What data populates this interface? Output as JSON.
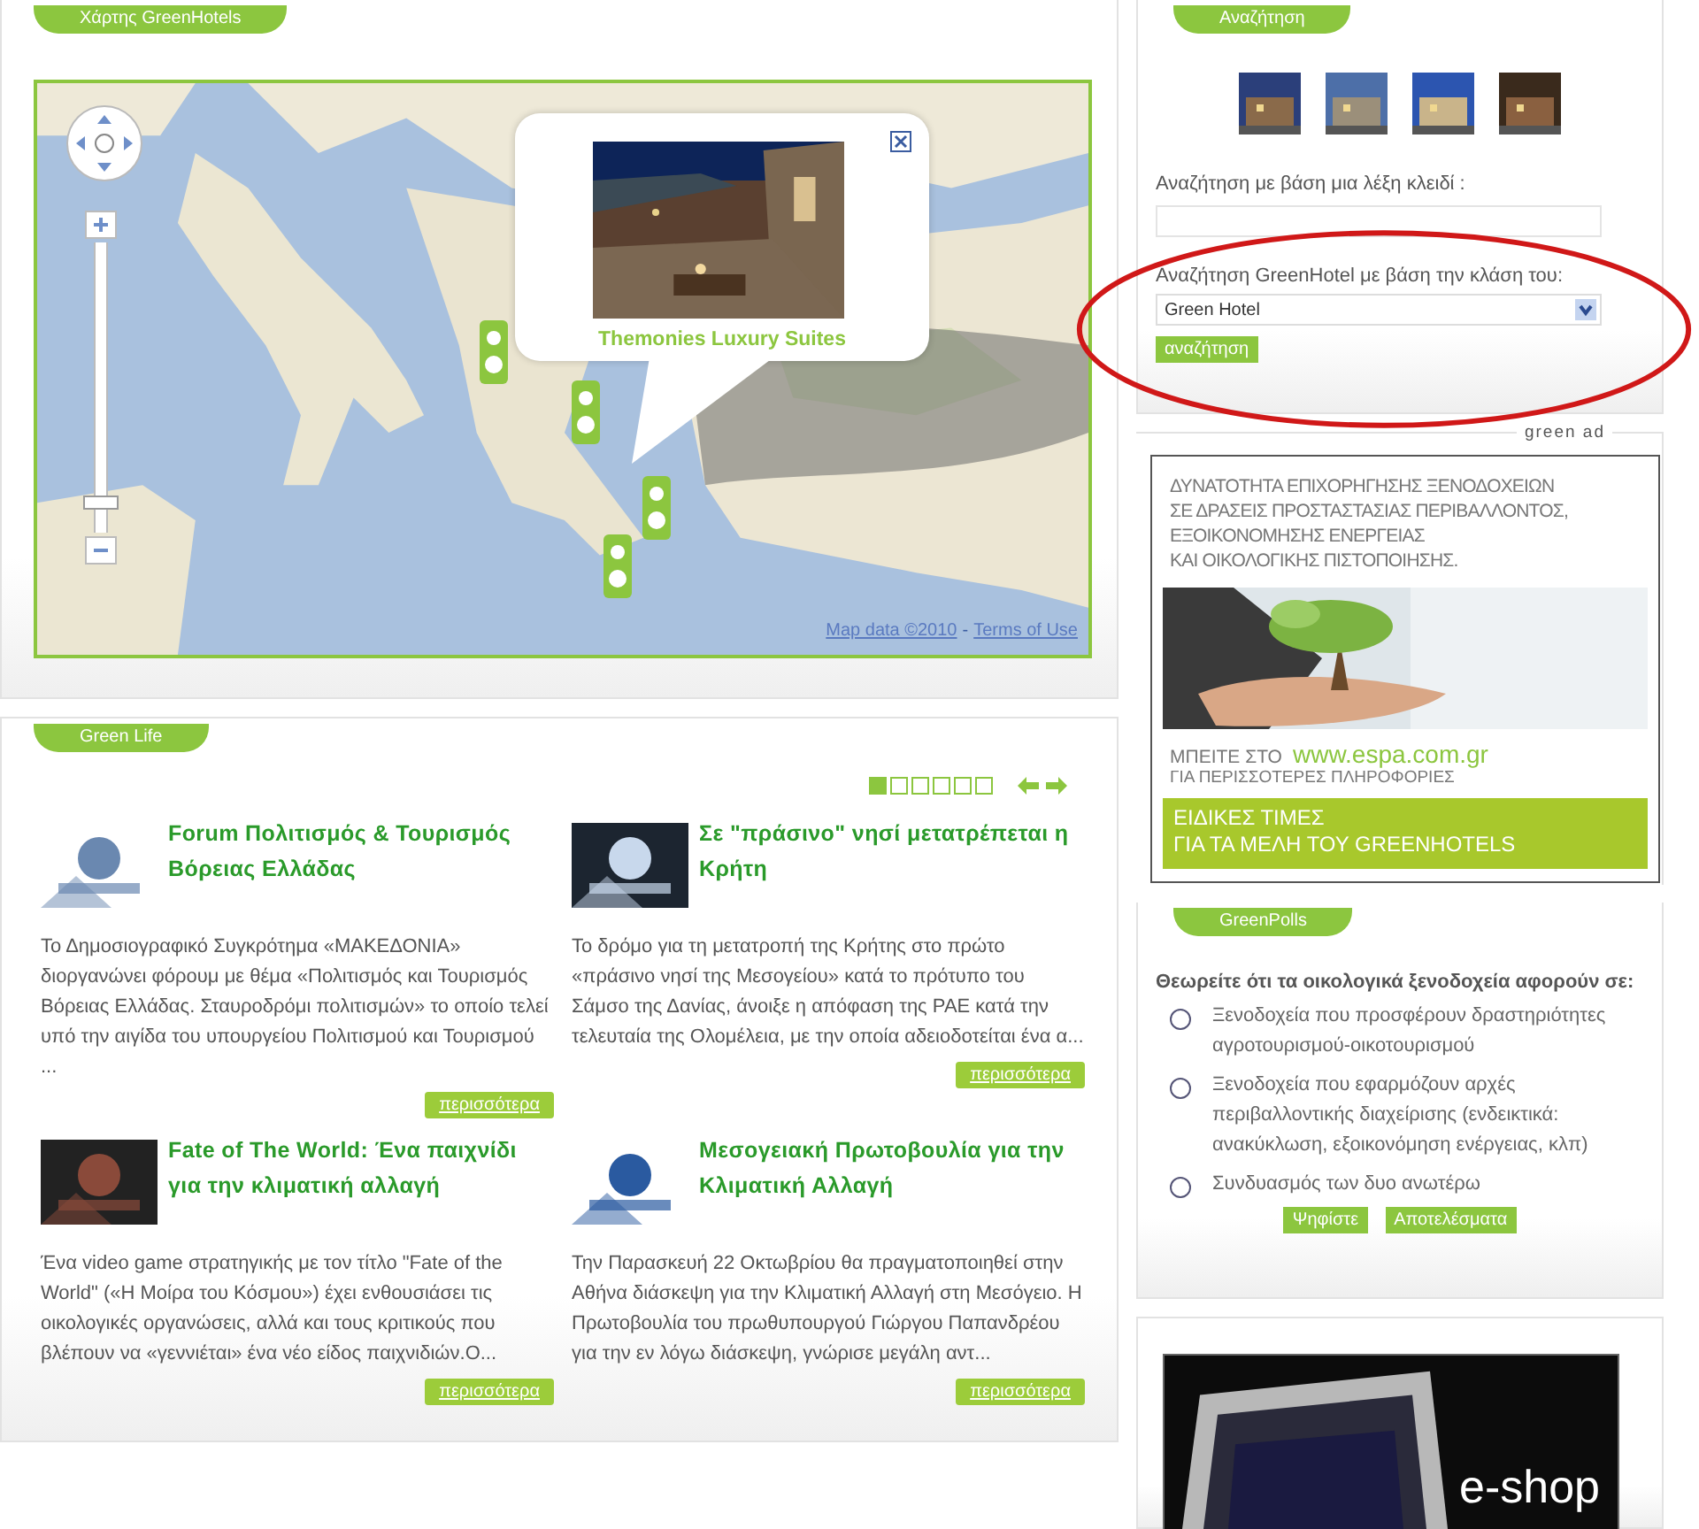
{
  "map_section": {
    "tab_label": "Χάρτης GreenHotels",
    "popup": {
      "title": "Themonies Luxury Suites"
    },
    "zoom": {
      "level": 0.08
    },
    "attribution": {
      "data_link": "Map data ©2010",
      "separator": "-",
      "terms_link": "Terms of Use"
    }
  },
  "search": {
    "tab_label": "Αναζήτηση",
    "keyword_label": "Αναζήτηση με βάση μια λέξη κλειδί :",
    "class_label": "Αναζήτηση GreenHotel με βάση την κλάση του:",
    "class_value": "Green Hotel",
    "button": "αναζήτηση"
  },
  "ad": {
    "caption": "green ad",
    "headline": [
      "ΔΥΝΑΤΟΤΗΤΑ ΕΠΙΧΟΡΗΓΗΣΗΣ ΞΕΝΟΔΟΧΕΙΩΝ",
      "ΣΕ ΔΡΑΣΕΙΣ ΠΡΟΣΤΑΣΤΑΣΙΑΣ ΠΕΡΙΒΑΛΛΟΝΤΟΣ,",
      "ΕΞΟΙΚΟΝΟΜΗΣΗΣ ΕΝΕΡΓΕΙΑΣ",
      "ΚΑΙ ΟΙΚΟΛΟΓΙΚΗΣ ΠΙΣΤΟΠΟΙΗΣΗΣ."
    ],
    "visit": "ΜΠΕΙΤΕ ΣΤΟ",
    "url": "www.espa.com.gr",
    "info": "ΓΙΑ ΠΕΡΙΣΣΟΤΕΡΕΣ ΠΛΗΡΟΦΟΡΙΕΣ",
    "band": [
      "ΕΙΔΙΚΕΣ ΤΙΜΕΣ",
      "ΓΙΑ ΤΑ ΜΕΛΗ ΤΟΥ GREENHOTELS"
    ]
  },
  "green_life": {
    "tab_label": "Green Life",
    "pages": [
      {
        "selected": true
      },
      {
        "selected": false
      },
      {
        "selected": false
      },
      {
        "selected": false
      },
      {
        "selected": false
      },
      {
        "selected": false
      }
    ],
    "articles": [
      {
        "title": "Forum Πολιτισμός & Τουρισμός Βόρειας Ελλάδας",
        "excerpt": " Το Δημοσιογραφικό Συγκρότημα «ΜΑΚΕΔΟΝΙΑ» διοργανώνει φόρουμ με θέμα «Πολιτισμός και Τουρισμός Βόρειας Ελλάδας. Σταυροδρόμι πολιτισμών» το οποίο τελεί υπό την αιγίδα του υπουργείου Πολιτισμού και Τουρισμού ...",
        "more": "περισσότερα"
      },
      {
        "title": "Σε \"πράσινο\" νησί μετατρέπεται η Κρήτη",
        "excerpt": " Το δρόμο για τη μετατροπή της Κρήτης στο πρώτο «πράσινο νησί της Μεσογείου» κατά το πρότυπο του Σάμσο της Δανίας, άνοιξε η απόφαση της ΡΑΕ κατά την τελευταία της Ολομέλεια, με την οποία αδειοδοτείται ένα α...",
        "more": "περισσότερα"
      },
      {
        "title": "Fate of The World: Ένα παιχνίδι για την κλιματική αλλαγή",
        "excerpt": " Ένα video game στρατηγικής με τον τίτλο \"Fate of the World\" («Η Μοίρα του Κόσμου») έχει ενθουσιάσει τις οικολογικές οργανώσεις, αλλά και τους κριτικούς που βλέπουν να «γεννιέται» ένα νέο είδος παιχνιδιών.Ο...",
        "more": "περισσότερα"
      },
      {
        "title": "Μεσογειακή Πρωτοβουλία για την Κλιματική Αλλαγή",
        "excerpt": "     Την Παρασκευή 22 Οκτωβρίου θα πραγματοποιηθεί στην Αθήνα διάσκεψη για την Κλιματική Αλλαγή στη Μεσόγειο. Η Πρωτοβουλία του πρωθυπουργού Γιώργου Παπανδρέου για την εν λόγω διάσκεψη, γνώρισε μεγάλη αντ...",
        "more": "περισσότερα"
      }
    ]
  },
  "polls": {
    "tab_label": "GreenPolls",
    "question": "Θεωρείτε ότι τα οικολογικά ξενοδοχεία αφορούν σε:",
    "options": [
      {
        "label": "Ξενοδοχεία που προσφέρουν δραστηριότητες αγροτουρισμού-οικοτουρισμού",
        "selected": false
      },
      {
        "label": "Ξενοδοχεία που εφαρμόζουν αρχές περιβαλλοντικής διαχείρισης (ενδεικτικά: ανακύκλωση, εξοικονόμηση ενέργειας, κλπ)",
        "selected": false
      },
      {
        "label": "Συνδυασμός των δυο ανωτέρω",
        "selected": false
      }
    ],
    "buttons": [
      "Ψηφίστε",
      "Αποτελέσματα"
    ]
  },
  "eshop": {
    "label": "e-shop"
  }
}
